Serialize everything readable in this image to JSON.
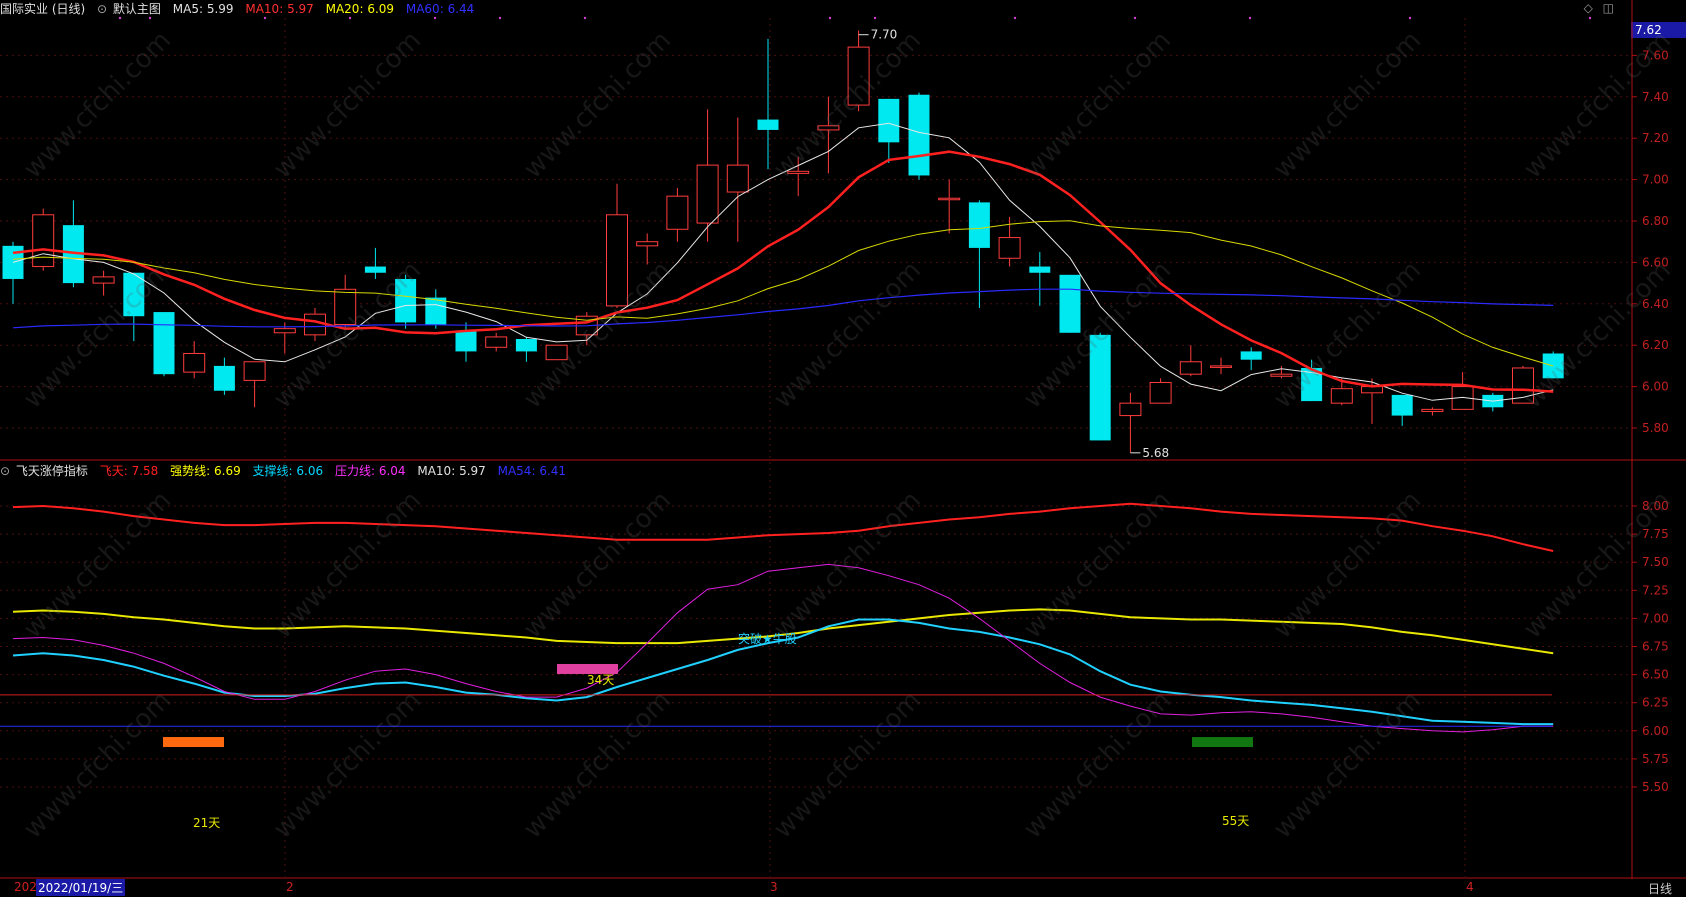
{
  "main_header": {
    "stock": "国际实业 (日线)",
    "template_label": "默认主图",
    "ma5": {
      "label": "MA5: ",
      "value": "5.99",
      "color": "#ffffff"
    },
    "ma10": {
      "label": "MA10: ",
      "value": "5.97",
      "color": "#ff3030"
    },
    "ma20": {
      "label": "MA20: ",
      "value": "6.09",
      "color": "#ffff00"
    },
    "ma60": {
      "label": "MA60: ",
      "value": "6.44",
      "color": "#2020ff"
    }
  },
  "sub_header": {
    "indicator": "飞天涨停指标",
    "feitian": {
      "label": "飞天: ",
      "value": "7.58",
      "color": "#ff2020"
    },
    "strong": {
      "label": "强势线: ",
      "value": "6.69",
      "color": "#ffff00"
    },
    "support": {
      "label": "支撑线: ",
      "value": "6.06",
      "color": "#00d8ff"
    },
    "pressure": {
      "label": "压力线: ",
      "value": "6.04",
      "color": "#ff30ff"
    },
    "ma10": {
      "label": "MA10: ",
      "value": "5.97",
      "color": "#ffffff"
    },
    "ma54": {
      "label": "MA54: ",
      "value": "6.41",
      "color": "#2020ff"
    }
  },
  "price_tag": "7.62",
  "main_axis": [
    "7.60",
    "7.40",
    "7.20",
    "7.00",
    "6.80",
    "6.60",
    "6.40",
    "6.20",
    "6.00",
    "5.80"
  ],
  "sub_axis": [
    "8.00",
    "7.75",
    "7.50",
    "7.25",
    "7.00",
    "6.75",
    "6.50",
    "6.25",
    "6.00",
    "5.75",
    "5.50"
  ],
  "annotations": {
    "high": "7.70",
    "low": "5.68",
    "breakout": "突破★牛股",
    "d21": "21天",
    "d34": "34天",
    "d55": "55天"
  },
  "date_bar": {
    "start": "202",
    "cursor_date": "2022/01/19/三",
    "m2": "2",
    "m3": "3",
    "m4": "4",
    "period": "日线"
  },
  "watermark": "www.cfchi.com",
  "chart_data": {
    "type": "candlestick",
    "candles": [
      [
        6.68,
        6.52,
        6.7,
        6.4
      ],
      [
        6.58,
        6.83,
        6.86,
        6.56
      ],
      [
        6.78,
        6.5,
        6.9,
        6.48
      ],
      [
        6.5,
        6.53,
        6.56,
        6.44
      ],
      [
        6.55,
        6.34,
        6.55,
        6.22
      ],
      [
        6.36,
        6.06,
        6.36,
        6.05
      ],
      [
        6.07,
        6.16,
        6.22,
        6.04
      ],
      [
        6.1,
        5.98,
        6.14,
        5.96
      ],
      [
        6.03,
        6.12,
        6.12,
        5.9
      ],
      [
        6.26,
        6.28,
        6.31,
        6.16
      ],
      [
        6.25,
        6.35,
        6.38,
        6.22
      ],
      [
        6.3,
        6.47,
        6.54,
        6.28
      ],
      [
        6.58,
        6.55,
        6.67,
        6.52
      ],
      [
        6.52,
        6.31,
        6.54,
        6.28
      ],
      [
        6.43,
        6.3,
        6.47,
        6.28
      ],
      [
        6.27,
        6.17,
        6.31,
        6.12
      ],
      [
        6.19,
        6.24,
        6.26,
        6.17
      ],
      [
        6.23,
        6.17,
        6.24,
        6.12
      ],
      [
        6.13,
        6.2,
        6.2,
        6.13
      ],
      [
        6.25,
        6.34,
        6.36,
        6.2
      ],
      [
        6.39,
        6.83,
        6.98,
        6.38
      ],
      [
        6.68,
        6.7,
        6.74,
        6.59
      ],
      [
        6.76,
        6.92,
        6.96,
        6.7
      ],
      [
        6.79,
        7.07,
        7.34,
        6.7
      ],
      [
        6.94,
        7.07,
        7.3,
        6.7
      ],
      [
        7.29,
        7.24,
        7.68,
        7.05
      ],
      [
        7.03,
        7.04,
        7.11,
        6.92
      ],
      [
        7.24,
        7.26,
        7.4,
        7.03
      ],
      [
        7.36,
        7.64,
        7.72,
        7.33
      ],
      [
        7.39,
        7.18,
        7.39,
        7.08
      ],
      [
        7.41,
        7.02,
        7.42,
        7.0
      ],
      [
        6.91,
        6.91,
        7.0,
        6.74
      ],
      [
        6.89,
        6.67,
        6.9,
        6.38
      ],
      [
        6.62,
        6.72,
        6.82,
        6.58
      ],
      [
        6.58,
        6.55,
        6.65,
        6.39
      ],
      [
        6.54,
        6.26,
        6.54,
        6.26
      ],
      [
        6.25,
        5.74,
        6.26,
        5.74
      ],
      [
        5.86,
        5.92,
        5.97,
        5.68
      ],
      [
        5.92,
        6.02,
        6.04,
        5.92
      ],
      [
        6.06,
        6.12,
        6.2,
        6.05
      ],
      [
        6.1,
        6.1,
        6.14,
        6.06
      ],
      [
        6.17,
        6.13,
        6.19,
        6.08
      ],
      [
        6.05,
        6.06,
        6.1,
        6.04
      ],
      [
        6.09,
        5.93,
        6.13,
        5.93
      ],
      [
        5.92,
        5.99,
        6.04,
        5.91
      ],
      [
        5.97,
        6.0,
        6.04,
        5.82
      ],
      [
        5.96,
        5.86,
        5.96,
        5.81
      ],
      [
        5.88,
        5.89,
        5.9,
        5.86
      ],
      [
        5.89,
        6.0,
        6.07,
        5.89
      ],
      [
        5.96,
        5.9,
        5.97,
        5.88
      ],
      [
        5.92,
        6.09,
        6.1,
        5.92
      ],
      [
        6.16,
        6.04,
        6.17,
        6.04
      ]
    ]
  }
}
